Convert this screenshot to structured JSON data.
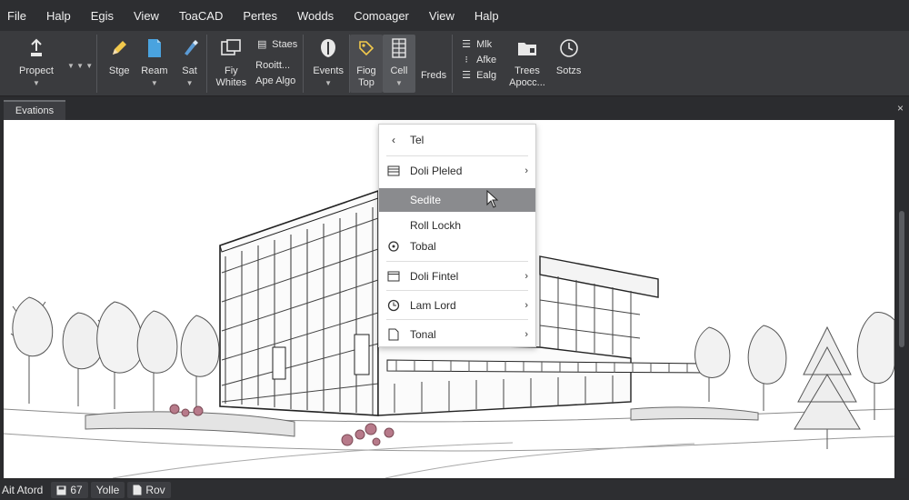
{
  "menubar": {
    "items": [
      "File",
      "Halp",
      "Egis",
      "View",
      "ToaCAD",
      "Pertes",
      "Wodds",
      "Comoager",
      "View",
      "Halp"
    ]
  },
  "ribbon": {
    "propect": "Propect",
    "stge": "Stge",
    "ream": "Ream",
    "sat": "Sat",
    "fiy_line1": "Fiy",
    "fiy_line2": "Whites",
    "small_group": [
      "Staes",
      "Rooitt...",
      "Ape Algo"
    ],
    "events": "Events",
    "fiog_line1": "Fiog",
    "fiog_line2": "Top",
    "cell": "Cell",
    "freds": "Freds",
    "right_small": [
      "Mlk",
      "Afke",
      "Ealg"
    ],
    "trees_line1": "Trees",
    "trees_line2": "Apocc...",
    "sotzs": "Sotzs"
  },
  "tabs": {
    "active_label": "Evations",
    "close_glyph": "×"
  },
  "context_menu": {
    "items": [
      {
        "label": "Tel",
        "icon": "chevron-left-icon",
        "submenu": false
      },
      {
        "label": "Doli Pleled",
        "icon": "list-icon",
        "submenu": true
      },
      {
        "label": "Sedite",
        "icon": "",
        "submenu": false,
        "highlighted": true
      },
      {
        "label": "Roll Lockh",
        "icon": "",
        "submenu": false
      },
      {
        "label": "Tobal",
        "icon": "rotate-icon",
        "submenu": false
      },
      {
        "label": "Doli Fintel",
        "icon": "window-icon",
        "submenu": true
      },
      {
        "label": "Lam Lord",
        "icon": "clock-icon",
        "submenu": true
      },
      {
        "label": "Tonal",
        "icon": "page-icon",
        "submenu": true
      }
    ]
  },
  "statusbar": {
    "items": [
      "Ait Atord",
      "67",
      "Yolle",
      "Rov"
    ]
  }
}
